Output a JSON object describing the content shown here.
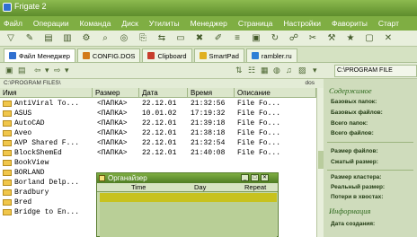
{
  "window": {
    "title": "Frigate 2"
  },
  "menu": [
    "Файл",
    "Операции",
    "Команда",
    "Диск",
    "Утилиты",
    "Менеджер",
    "Страница",
    "Настройки",
    "Фавориты",
    "Старт"
  ],
  "tabs": [
    {
      "label": "Файл Менеджер",
      "color": "#2f6fd0"
    },
    {
      "label": "CONFIG.DOS",
      "color": "#d27a1a"
    },
    {
      "label": "Clipboard",
      "color": "#c73d2c"
    },
    {
      "label": "SmartPad",
      "color": "#e0b020"
    },
    {
      "label": "rambler.ru",
      "color": "#2d7fd6"
    }
  ],
  "nav": {
    "path": "C:\\PROGRAM FILE"
  },
  "file_pane": {
    "path": "C:\\PROGRAM FILES\\",
    "status": "dos",
    "columns": [
      "Имя",
      "Размер",
      "Дата",
      "Время",
      "Описание"
    ],
    "rows": [
      {
        "name": "AntiViral To...",
        "size": "<ПАПКА>",
        "date": "22.12.01",
        "time": "21:32:56",
        "desc": "File Fo..."
      },
      {
        "name": "ASUS",
        "size": "<ПАПКА>",
        "date": "10.01.02",
        "time": "17:19:32",
        "desc": "File Fo..."
      },
      {
        "name": "AutoCAD",
        "size": "<ПАПКА>",
        "date": "22.12.01",
        "time": "21:39:18",
        "desc": "File Fo..."
      },
      {
        "name": "Aveo",
        "size": "<ПАПКА>",
        "date": "22.12.01",
        "time": "21:38:18",
        "desc": "File Fo..."
      },
      {
        "name": "AVP Shared F...",
        "size": "<ПАПКА>",
        "date": "22.12.01",
        "time": "21:32:54",
        "desc": "File Fo..."
      },
      {
        "name": "BlockShemEd",
        "size": "<ПАПКА>",
        "date": "22.12.01",
        "time": "21:40:08",
        "desc": "File Fo..."
      },
      {
        "name": "BookView",
        "size": "",
        "date": "",
        "time": "",
        "desc": ""
      },
      {
        "name": "BORLAND",
        "size": "",
        "date": "",
        "time": "",
        "desc": ""
      },
      {
        "name": "Borland Delp...",
        "size": "",
        "date": "",
        "time": "",
        "desc": ""
      },
      {
        "name": "Bradbury",
        "size": "",
        "date": "",
        "time": "",
        "desc": ""
      },
      {
        "name": "Bred",
        "size": "",
        "date": "",
        "time": "",
        "desc": ""
      },
      {
        "name": "Bridge to En...",
        "size": "",
        "date": "",
        "time": "",
        "desc": ""
      }
    ]
  },
  "organizer": {
    "title": "Органайзер",
    "columns": [
      "Time",
      "Day",
      "Repeat"
    ]
  },
  "right_panel": {
    "contents_heading": "Содержимое",
    "contents_items": [
      "Базовых папок:",
      "Базовых файлов:",
      "Всего папок:",
      "Всего файлов:"
    ],
    "size_items": [
      "Размер файлов:",
      "Сжатый размер:"
    ],
    "cluster_items": [
      "Размер кластера:",
      "Реальный размер:",
      "Потери в хвостах:"
    ],
    "info_heading": "Информация",
    "info_items": [
      "Дата создания:"
    ]
  }
}
